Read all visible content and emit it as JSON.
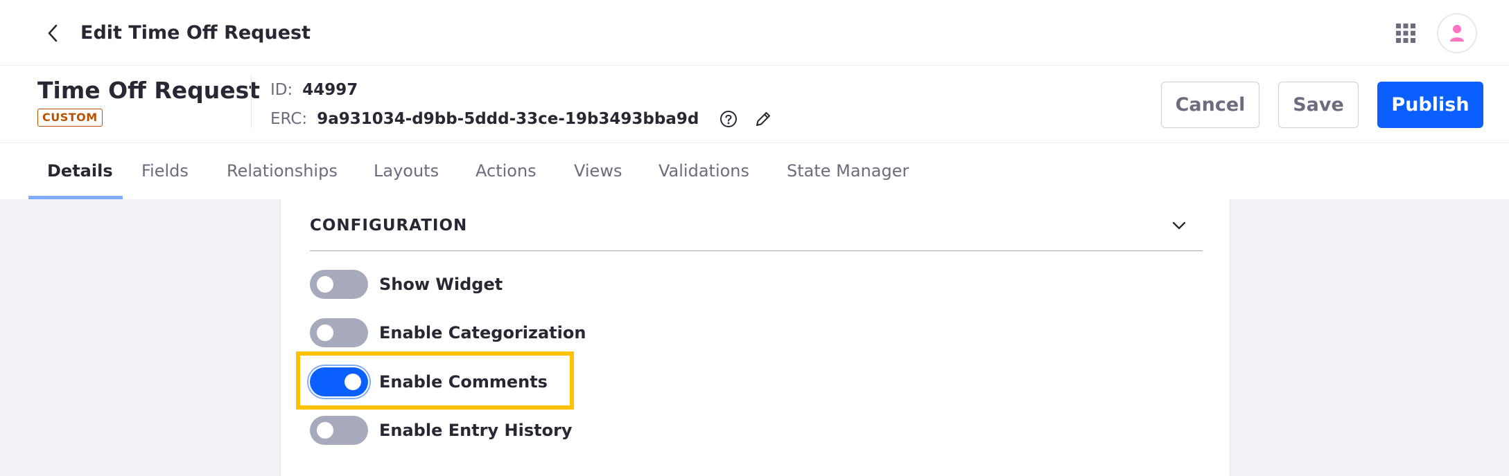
{
  "topbar": {
    "title": "Edit Time Off Request",
    "back_icon": "chevron-left-icon",
    "apps_icon": "apps-grid-icon",
    "avatar_icon": "user-icon"
  },
  "header": {
    "object_title": "Time Off Request",
    "badge": "CUSTOM",
    "id_label": "ID:",
    "id_value": "44997",
    "erc_label": "ERC:",
    "erc_value": "9a931034-d9bb-5ddd-33ce-19b3493bba9d",
    "cancel_label": "Cancel",
    "save_label": "Save",
    "publish_label": "Publish"
  },
  "tabs": [
    {
      "label": "Details",
      "active": true
    },
    {
      "label": "Fields",
      "active": false
    },
    {
      "label": "Relationships",
      "active": false
    },
    {
      "label": "Layouts",
      "active": false
    },
    {
      "label": "Actions",
      "active": false
    },
    {
      "label": "Views",
      "active": false
    },
    {
      "label": "Validations",
      "active": false
    },
    {
      "label": "State Manager",
      "active": false
    }
  ],
  "configuration": {
    "title": "CONFIGURATION",
    "toggles": [
      {
        "label": "Show Widget",
        "checked": false
      },
      {
        "label": "Enable Categorization",
        "checked": false
      },
      {
        "label": "Enable Comments",
        "checked": true
      },
      {
        "label": "Enable Entry History",
        "checked": false
      }
    ]
  },
  "colors": {
    "primary": "#0b5fff",
    "badge": "#b95000",
    "highlight": "#ffc200",
    "toggle_off": "#a7a9bc"
  }
}
